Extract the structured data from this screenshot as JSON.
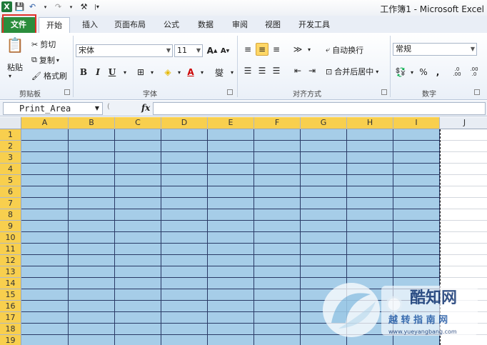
{
  "window": {
    "title": "工作簿1 - Microsoft Excel"
  },
  "quick_access": {
    "logo": "X",
    "save_icon": "save-icon",
    "undo_icon": "undo-icon",
    "redo_icon": "redo-icon"
  },
  "tabs": [
    "文件",
    "开始",
    "插入",
    "页面布局",
    "公式",
    "数据",
    "审阅",
    "视图",
    "开发工具"
  ],
  "clipboard": {
    "paste": "粘贴",
    "cut": "剪切",
    "copy": "复制",
    "format_painter": "格式刷",
    "label": "剪贴板"
  },
  "font": {
    "name": "宋体",
    "size": "11",
    "bold": "B",
    "italic": "I",
    "underline": "U",
    "grow": "A",
    "shrink": "A",
    "label": "字体",
    "phonetic": "燮"
  },
  "alignment": {
    "wrap": "自动换行",
    "merge": "合并后居中",
    "label": "对齐方式"
  },
  "number": {
    "format": "常规",
    "percent": "%",
    "comma": ",",
    "inc": ".0 .00",
    "dec": ".00 .0",
    "label": "数字"
  },
  "formula_bar": {
    "name_box": "Print_Area",
    "fx": "fx",
    "value": ""
  },
  "columns": [
    "A",
    "B",
    "C",
    "D",
    "E",
    "F",
    "G",
    "H",
    "I",
    "J"
  ],
  "rows": [
    "1",
    "2",
    "3",
    "4",
    "5",
    "6",
    "7",
    "8",
    "9",
    "10",
    "11",
    "12",
    "13",
    "14",
    "15",
    "16",
    "17",
    "18",
    "19"
  ],
  "colors": {
    "selection": "#a6cde8",
    "header_highlight": "#f8cf4e",
    "file_tab": "#2b8d3c",
    "highlight_box": "#e0302a"
  },
  "watermark": {
    "text1": "酷知网",
    "text2": "越 转 指 南 网",
    "url": "www.yueyangbang.com"
  }
}
